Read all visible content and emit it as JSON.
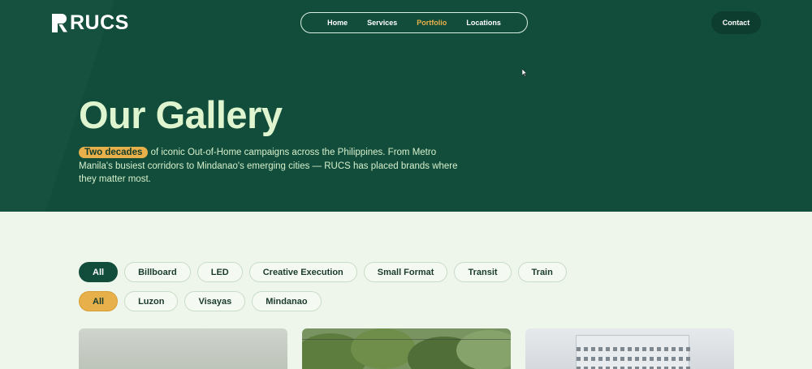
{
  "brand": {
    "name": "RUCS"
  },
  "nav": {
    "items": [
      {
        "label": "Home",
        "active": false
      },
      {
        "label": "Services",
        "active": false
      },
      {
        "label": "Portfolio",
        "active": true
      },
      {
        "label": "Locations",
        "active": false
      }
    ],
    "contact_label": "Contact"
  },
  "hero": {
    "title": "Our Gallery",
    "highlight": "Two decades",
    "description": " of iconic Out-of-Home campaigns across the Philippines. From Metro Manila's busiest corridors to Mindanao's emerging cities — RUCS has placed brands where they matter most."
  },
  "filters": {
    "categories": [
      "All",
      "Billboard",
      "LED",
      "Creative Execution",
      "Small Format",
      "Transit",
      "Train"
    ],
    "selected_category": "All",
    "regions": [
      "All",
      "Luzon",
      "Visayas",
      "Mindanao"
    ],
    "selected_region": "All"
  },
  "colors": {
    "hero_bg": "#124d3b",
    "accent": "#e8b04a",
    "page_bg": "#eef6ec"
  },
  "icons": {
    "cursor": "cursor-arrow-icon"
  }
}
